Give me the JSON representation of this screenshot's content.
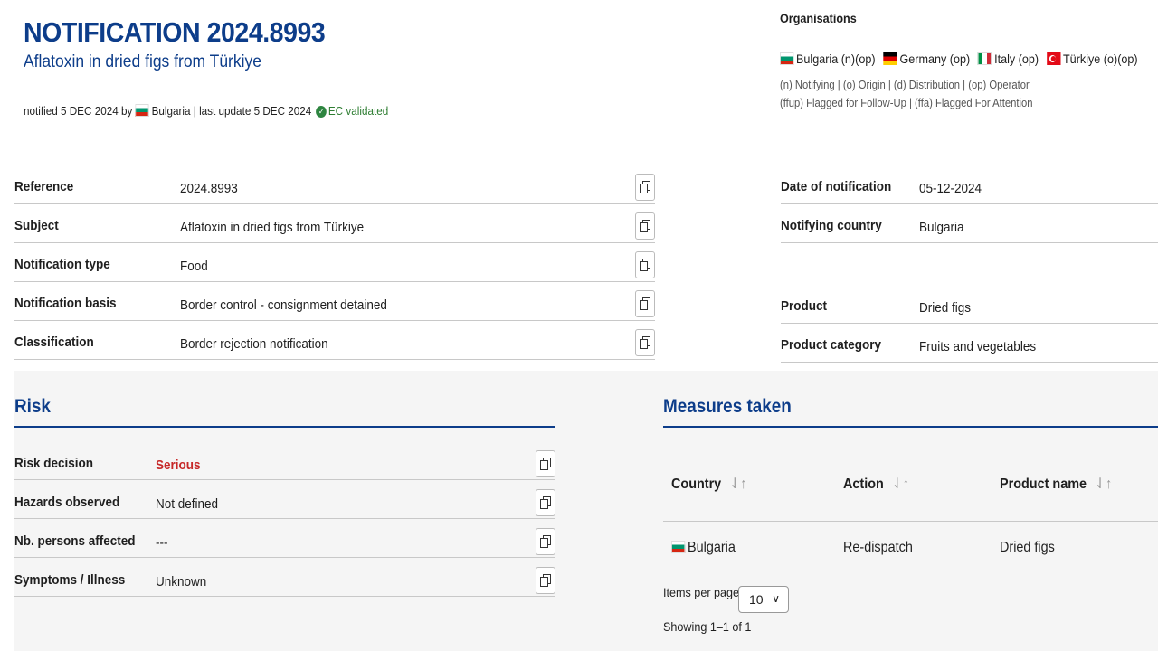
{
  "header": {
    "title": "NOTIFICATION 2024.8993",
    "subtitle": "Aflatoxin in dried figs from Türkiye",
    "notified_prefix": "notified 5 DEC 2024 by",
    "notified_country": "Bulgaria",
    "last_update": "| last update 5 DEC 2024",
    "validation": "EC validated"
  },
  "organisations": {
    "title": "Organisations",
    "items": [
      {
        "flag": "bg",
        "label": "Bulgaria (n)(op)"
      },
      {
        "flag": "de",
        "label": "Germany (op)"
      },
      {
        "flag": "it",
        "label": "Italy (op)"
      },
      {
        "flag": "tr",
        "label": "Türkiye (o)(op)"
      }
    ],
    "legend1": "(n) Notifying | (o) Origin | (d) Distribution | (op) Operator",
    "legend2": "(ffup) Flagged for Follow-Up | (ffa) Flagged For Attention"
  },
  "details_left": [
    {
      "label": "Reference",
      "value": "2024.8993"
    },
    {
      "label": "Subject",
      "value": "Aflatoxin in dried figs from Türkiye"
    },
    {
      "label": "Notification type",
      "value": "Food"
    },
    {
      "label": "Notification basis",
      "value": "Border control - consignment detained"
    },
    {
      "label": "Classification",
      "value": "Border rejection notification"
    }
  ],
  "details_right": [
    {
      "label": "Date of notification",
      "value": "05-12-2024"
    },
    {
      "label": "Notifying country",
      "value": "Bulgaria"
    },
    {
      "label": "Product",
      "value": "Dried figs"
    },
    {
      "label": "Product category",
      "value": "Fruits and vegetables"
    }
  ],
  "risk": {
    "title": "Risk",
    "rows": [
      {
        "label": "Risk decision",
        "value": "Serious"
      },
      {
        "label": "Hazards observed",
        "value": "Not defined"
      },
      {
        "label": "Nb. persons affected",
        "value": "---"
      },
      {
        "label": "Symptoms / Illness",
        "value": "Unknown"
      }
    ]
  },
  "measures": {
    "title": "Measures taken",
    "columns": [
      "Country",
      "Action",
      "Product name"
    ],
    "rows": [
      {
        "country": "Bulgaria",
        "action": "Re-dispatch",
        "product": "Dried figs"
      }
    ],
    "items_per_page_label": "Items per page:",
    "items_per_page_value": "10",
    "showing": "Showing 1–1 of 1"
  },
  "icons": {
    "copy": "copy-icon",
    "sort": "sort-arrows-icon",
    "check": "check-circle-icon",
    "chevron": "chevron-down-icon"
  },
  "colors": {
    "title_blue": "#0d3d8a",
    "serious_red": "#c62828",
    "validated_green": "#2e7d32",
    "panel_gray": "#f5f5f5"
  }
}
